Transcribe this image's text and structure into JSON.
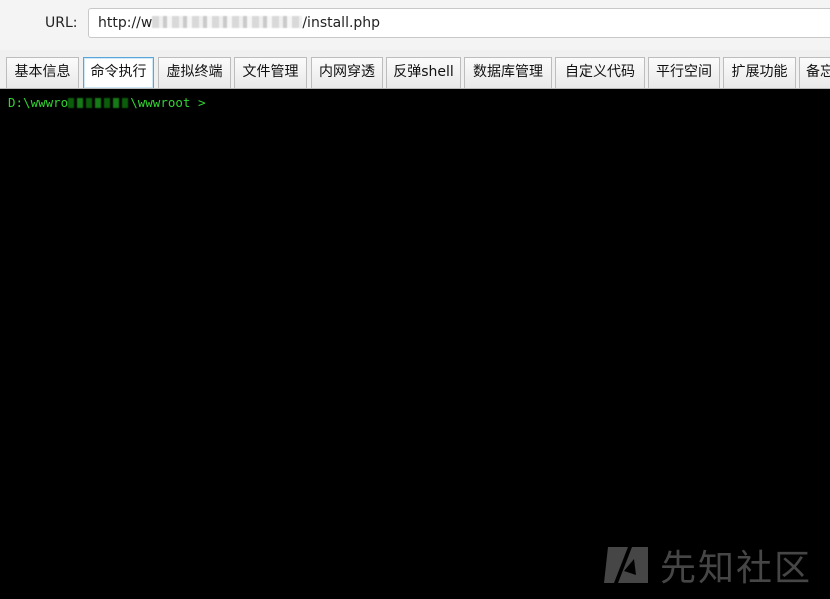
{
  "url_bar": {
    "label": "URL:",
    "value_prefix": "http://w",
    "value_suffix": "/install.php"
  },
  "tabs": [
    {
      "label": "基本信息",
      "active": false
    },
    {
      "label": "命令执行",
      "active": true
    },
    {
      "label": "虚拟终端",
      "active": false
    },
    {
      "label": "文件管理",
      "active": false
    },
    {
      "label": "内网穿透",
      "active": false
    },
    {
      "label": "反弹shell",
      "active": false
    },
    {
      "label": "数据库管理",
      "active": false
    },
    {
      "label": "自定义代码",
      "active": false
    },
    {
      "label": "平行空间",
      "active": false
    },
    {
      "label": "扩展功能",
      "active": false
    },
    {
      "label": "备忘",
      "active": false
    }
  ],
  "terminal": {
    "prompt_prefix": "D:\\wwwro",
    "prompt_suffix": "\\wwwroot >",
    "text_color": "#31d431",
    "background": "#000000"
  },
  "watermark": {
    "text": "先知社区",
    "logo_icon": "xianzhi-logo-icon"
  }
}
